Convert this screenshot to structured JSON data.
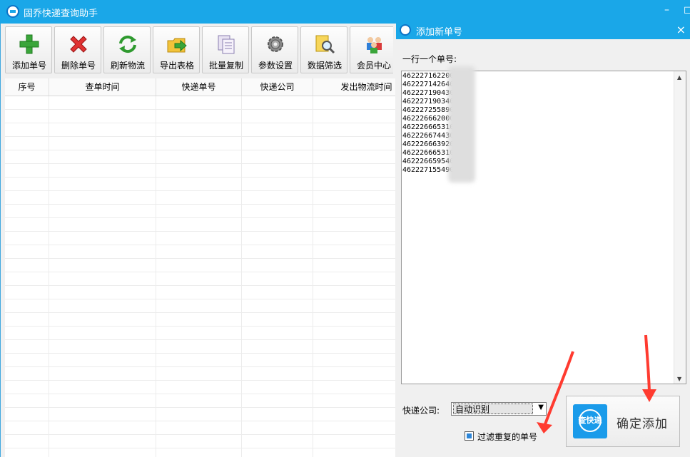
{
  "main_window": {
    "title": "固乔快递查询助手",
    "minimize": "–",
    "restore": "◻"
  },
  "toolbar": [
    {
      "label": "添加单号",
      "icon": "add-icon"
    },
    {
      "label": "删除单号",
      "icon": "delete-icon"
    },
    {
      "label": "刷新物流",
      "icon": "refresh-icon"
    },
    {
      "label": "导出表格",
      "icon": "export-icon"
    },
    {
      "label": "批量复制",
      "icon": "copy-icon"
    },
    {
      "label": "参数设置",
      "icon": "settings-icon"
    },
    {
      "label": "数据筛选",
      "icon": "filter-icon"
    },
    {
      "label": "会员中心",
      "icon": "member-icon"
    }
  ],
  "grid": {
    "columns": [
      "序号",
      "查单时间",
      "快递单号",
      "快递公司",
      "发出物流时间"
    ]
  },
  "dialog": {
    "title": "添加新单号",
    "close": "×",
    "prompt": "一行一个单号:",
    "tracking_numbers": [
      "462227162200",
      "462227142640",
      "462227190430",
      "462227190340",
      "462227255890",
      "462226662000",
      "462226665310",
      "462226674430",
      "462226663920",
      "462226665310",
      "462226659540",
      "462227155490"
    ],
    "company_label": "快递公司:",
    "company_value": "自动识别",
    "filter_label": "过滤重复的单号",
    "filter_checked": true,
    "confirm_label": "确定添加",
    "confirm_logo_text": "查快递"
  },
  "colors": {
    "titlebar": "#1aa7e8",
    "annotation_arrow": "#ff3b30"
  }
}
